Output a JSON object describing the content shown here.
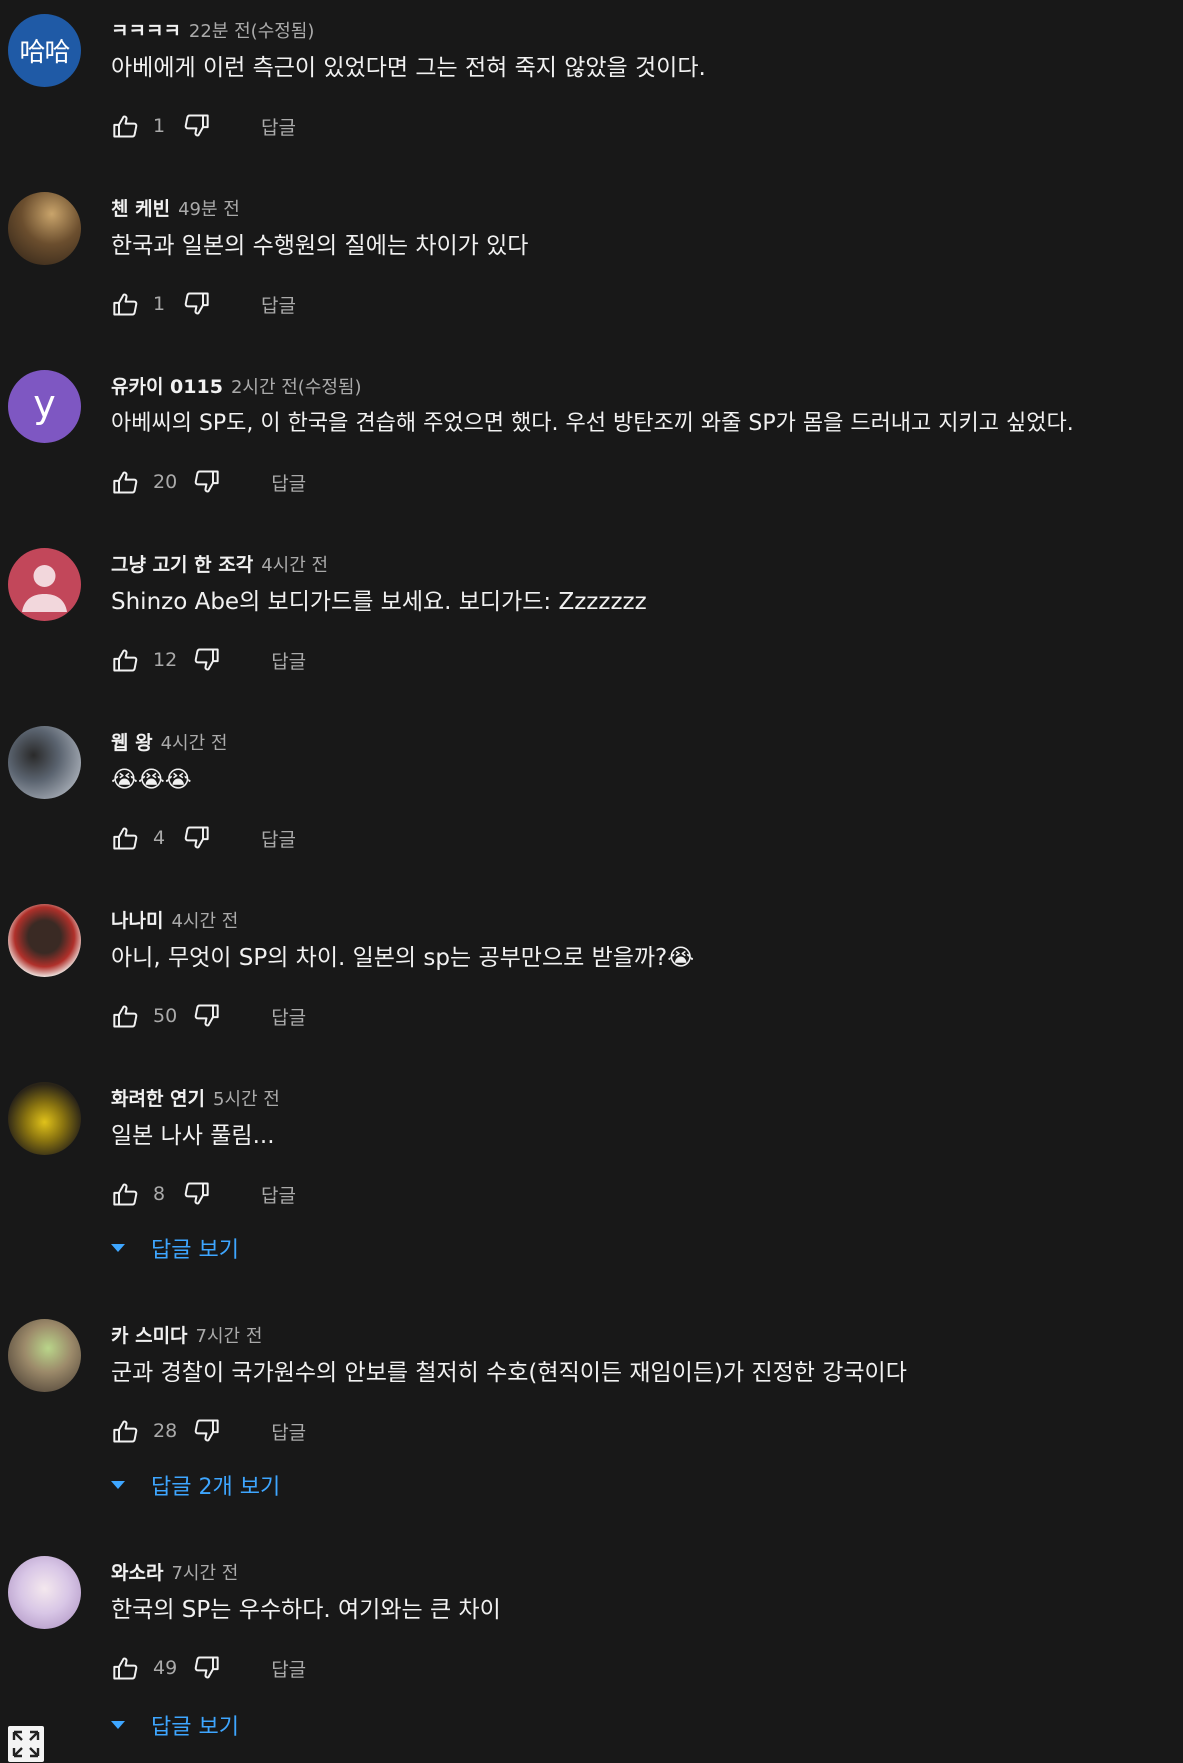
{
  "comments": [
    {
      "author": "ㅋㅋㅋㅋ",
      "time": "22분 전(수정됨)",
      "text": "아베에게 이런 측근이 있었다면 그는 전혀 죽지 않았을 것이다.",
      "likes": "1",
      "reply_label": "답글",
      "avatar": {
        "type": "text",
        "value": "哈哈",
        "color": "#1f5aa6"
      }
    },
    {
      "author": "첸 케빈",
      "time": "49분 전",
      "text": "한국과 일본의 수행원의 질에는 차이가 있다",
      "likes": "1",
      "reply_label": "답글",
      "avatar": {
        "type": "photo",
        "color": "#5a4a3a"
      }
    },
    {
      "author": "유카이 0115",
      "time": "2시간 전(수정됨)",
      "text": "아베씨의 SP도, 이 한국을 견습해 주었으면 했다. 우선 방탄조끼 와줄 SP가 몸을 드러내고 지키고 싶었다.",
      "likes": "20",
      "reply_label": "답글",
      "avatar": {
        "type": "letter",
        "value": "y",
        "color": "#7e57c2"
      }
    },
    {
      "author": "그냥 고기 한 조각",
      "time": "4시간 전",
      "text": "Shinzo Abe의 보디가드를 보세요. 보디가드: Zzzzzzz",
      "likes": "12",
      "reply_label": "답글",
      "avatar": {
        "type": "person",
        "color": "#c2475a"
      }
    },
    {
      "author": "웹 왕",
      "time": "4시간 전",
      "text": "😭😭😭",
      "likes": "4",
      "reply_label": "답글",
      "avatar": {
        "type": "photo",
        "color": "#9aa4b0"
      }
    },
    {
      "author": "나나미",
      "time": "4시간 전",
      "text": "아니, 무엇이 SP의 차이. 일본의 sp는 공부만으로 받을까?😭",
      "likes": "50",
      "reply_label": "답글",
      "avatar": {
        "type": "photo",
        "color": "#e9e4e0"
      }
    },
    {
      "author": "화려한 연기",
      "time": "5시간 전",
      "text": "일본 나사 풀림...",
      "likes": "8",
      "reply_label": "답글",
      "avatar": {
        "type": "photo",
        "color": "#3b3520"
      },
      "replies_toggle": "답글 보기"
    },
    {
      "author": "카 스미다",
      "time": "7시간 전",
      "text": "군과 경찰이 국가원수의 안보를 철저히 수호(현직이든 재임이든)가 진정한 강국이다",
      "likes": "28",
      "reply_label": "답글",
      "avatar": {
        "type": "photo",
        "color": "#6b5a4a"
      },
      "replies_toggle": "답글 2개 보기"
    },
    {
      "author": "와소라",
      "time": "7시간 전",
      "text": "한국의 SP는 우수하다. 여기와는 큰 차이",
      "likes": "49",
      "reply_label": "답글",
      "avatar": {
        "type": "photo",
        "color": "#d8c6e6"
      },
      "replies_toggle": "답글 보기"
    }
  ]
}
